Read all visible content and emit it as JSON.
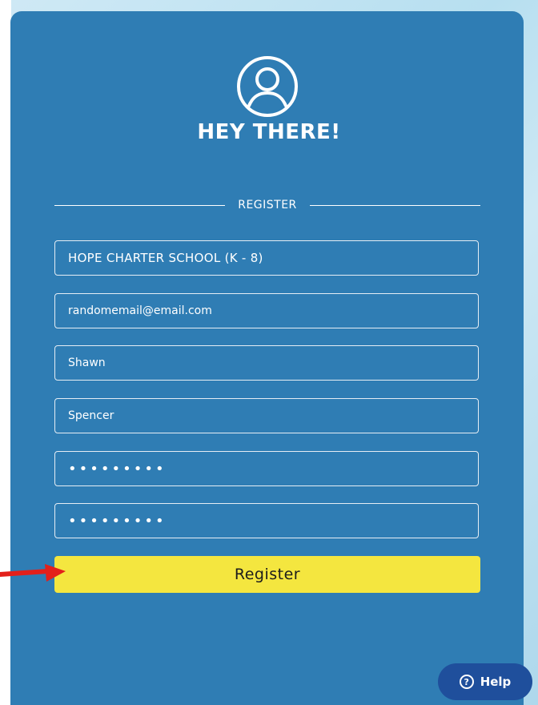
{
  "header": {
    "title": "HEY THERE!",
    "avatar_icon": "user-circle-icon"
  },
  "divider": {
    "label": "REGISTER"
  },
  "form": {
    "school_value": "HOPE CHARTER SCHOOL (K - 8)",
    "email_value": "randomemail@email.com",
    "first_name_value": "Shawn",
    "last_name_value": "Spencer",
    "password_value": "•••••••••",
    "confirm_password_value": "•••••••••",
    "register_label": "Register"
  },
  "help": {
    "label": "Help",
    "icon": "question-circle-icon",
    "icon_glyph": "?"
  },
  "annotation": {
    "arrow_icon": "red-arrow-icon",
    "arrow_color": "#e3201b"
  },
  "colors": {
    "card_bg": "#2f7db4",
    "button_yellow": "#f4e63f",
    "help_bg": "#1f4f9c"
  }
}
